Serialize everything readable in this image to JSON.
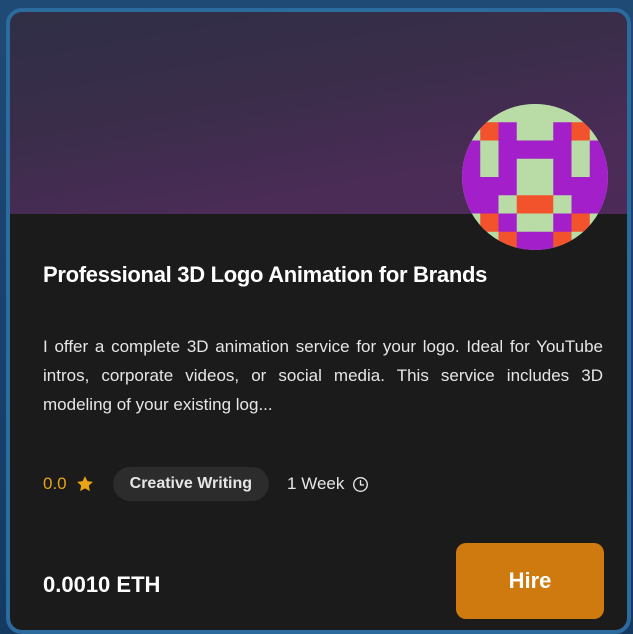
{
  "card": {
    "title": "Professional 3D Logo Animation for Brands",
    "description": "I offer a complete 3D animation service for your logo. Ideal for YouTube intros, corporate videos, or social media. This service includes 3D modeling of your existing log...",
    "rating": "0.0",
    "category": "Creative Writing",
    "duration": "1 Week",
    "price": "0.0010 ETH",
    "hire_label": "Hire"
  },
  "colors": {
    "accent": "#cf7a0e",
    "star": "#e8a317",
    "card_border": "#2c6b9e",
    "avatar_purple": "#a21fc9",
    "avatar_green": "#b9dca6",
    "avatar_red": "#f2522c"
  },
  "icons": {
    "rating": "star-icon",
    "duration": "clock-icon"
  }
}
